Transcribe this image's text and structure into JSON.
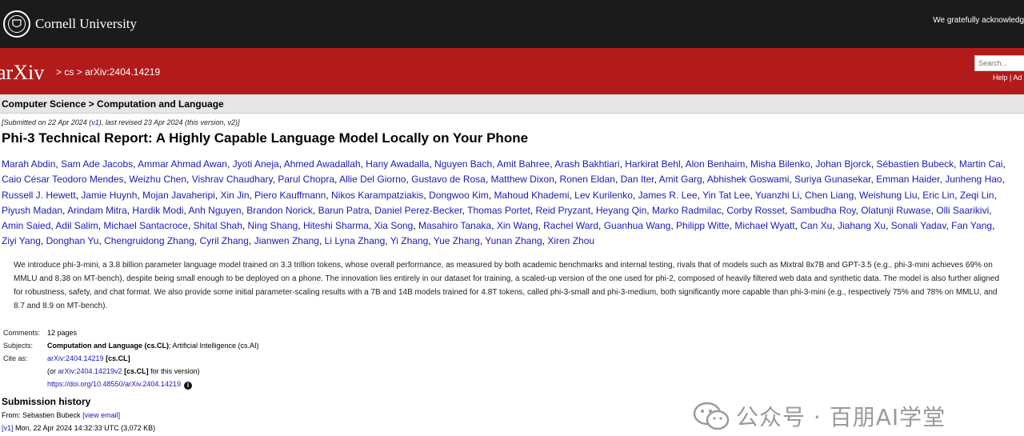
{
  "header": {
    "institution": "Cornell University",
    "acknowledgement": "We gratefully acknowledg"
  },
  "arxiv": {
    "logo_text": "arXiv",
    "crumb_sep1": ">",
    "crumb_cs": "cs",
    "crumb_sep2": ">",
    "crumb_id": "arXiv:2404.14219",
    "search_placeholder": "Search...",
    "help_label": "Help",
    "help_sep": "|",
    "advanced_label": "Ad"
  },
  "category": "Computer Science > Computation and Language",
  "submitted": {
    "prefix": "[Submitted on 22 Apr 2024 (",
    "v1": "v1",
    "suffix": "), last revised 23 Apr 2024 (this version, v2)]"
  },
  "title": "Phi-3 Technical Report: A Highly Capable Language Model Locally on Your Phone",
  "authors": [
    "Marah Abdin",
    "Sam Ade Jacobs",
    "Ammar Ahmad Awan",
    "Jyoti Aneja",
    "Ahmed Awadallah",
    "Hany Awadalla",
    "Nguyen Bach",
    "Amit Bahree",
    "Arash Bakhtiari",
    "Harkirat Behl",
    "Alon Benhaim",
    "Misha Bilenko",
    "Johan Bjorck",
    "Sébastien Bubeck",
    "Martin Cai",
    "Caio César Teodoro Mendes",
    "Weizhu Chen",
    "Vishrav Chaudhary",
    "Parul Chopra",
    "Allie Del Giorno",
    "Gustavo de Rosa",
    "Matthew Dixon",
    "Ronen Eldan",
    "Dan Iter",
    "Amit Garg",
    "Abhishek Goswami",
    "Suriya Gunasekar",
    "Emman Haider",
    "Junheng Hao",
    "Russell J. Hewett",
    "Jamie Huynh",
    "Mojan Javaheripi",
    "Xin Jin",
    "Piero Kauffmann",
    "Nikos Karampatziakis",
    "Dongwoo Kim",
    "Mahoud Khademi",
    "Lev Kurilenko",
    "James R. Lee",
    "Yin Tat Lee",
    "Yuanzhi Li",
    "Chen Liang",
    "Weishung Liu",
    "Eric Lin",
    "Zeqi Lin",
    "Piyush Madan",
    "Arindam Mitra",
    "Hardik Modi",
    "Anh Nguyen",
    "Brandon Norick",
    "Barun Patra",
    "Daniel Perez-Becker",
    "Thomas Portet",
    "Reid Pryzant",
    "Heyang Qin",
    "Marko Radmilac",
    "Corby Rosset",
    "Sambudha Roy",
    "Olatunji Ruwase",
    "Olli Saarikivi",
    "Amin Saied",
    "Adil Salim",
    "Michael Santacroce",
    "Shital Shah",
    "Ning Shang",
    "Hiteshi Sharma",
    "Xia Song",
    "Masahiro Tanaka",
    "Xin Wang",
    "Rachel Ward",
    "Guanhua Wang",
    "Philipp Witte",
    "Michael Wyatt",
    "Can Xu",
    "Jiahang Xu",
    "Sonali Yadav",
    "Fan Yang",
    "Ziyi Yang",
    "Donghan Yu",
    "Chengruidong Zhang",
    "Cyril Zhang",
    "Jianwen Zhang",
    "Li Lyna Zhang",
    "Yi Zhang",
    "Yue Zhang",
    "Yunan Zhang",
    "Xiren Zhou"
  ],
  "abstract": "We introduce phi-3-mini, a 3.8 billion parameter language model trained on 3.3 trillion tokens, whose overall performance, as measured by both academic benchmarks and internal testing, rivals that of models such as Mixtral 8x7B and GPT-3.5 (e.g., phi-3-mini achieves 69% on MMLU and 8.38 on MT-bench), despite being small enough to be deployed on a phone. The innovation lies entirely in our dataset for training, a scaled-up version of the one used for phi-2, composed of heavily filtered web data and synthetic data. The model is also further aligned for robustness, safety, and chat format. We also provide some initial parameter-scaling results with a 7B and 14B models trained for 4.8T tokens, called phi-3-small and phi-3-medium, both significantly more capable than phi-3-mini (e.g., respectively 75% and 78% on MMLU, and 8.7 and 8.9 on MT-bench).",
  "meta": {
    "comments_label": "Comments:",
    "comments_value": "12 pages",
    "subjects_label": "Subjects:",
    "subjects_primary": "Computation and Language (cs.CL)",
    "subjects_rest": "; Artificial Intelligence (cs.AI)",
    "cite_label": "Cite as:",
    "cite_id": "arXiv:2404.14219",
    "cite_cat": "[cs.CL]",
    "cite2_prefix": "(or ",
    "cite2_id": "arXiv:2404.14219v2",
    "cite2_cat": "[cs.CL]",
    "cite2_suffix": " for this version)",
    "doi": "https://doi.org/10.48550/arXiv.2404.14219",
    "doi_icon": "i"
  },
  "history": {
    "title": "Submission history",
    "from_prefix": "From: Sebastien Bubeck ",
    "view_email": "[view email]",
    "v1_link": "[v1]",
    "v1_text": " Mon, 22 Apr 2024 14:32:33 UTC (3,072 KB)"
  },
  "watermark": {
    "text": "公众号 · 百朋AI学堂",
    "icon": "wechat-icon"
  }
}
